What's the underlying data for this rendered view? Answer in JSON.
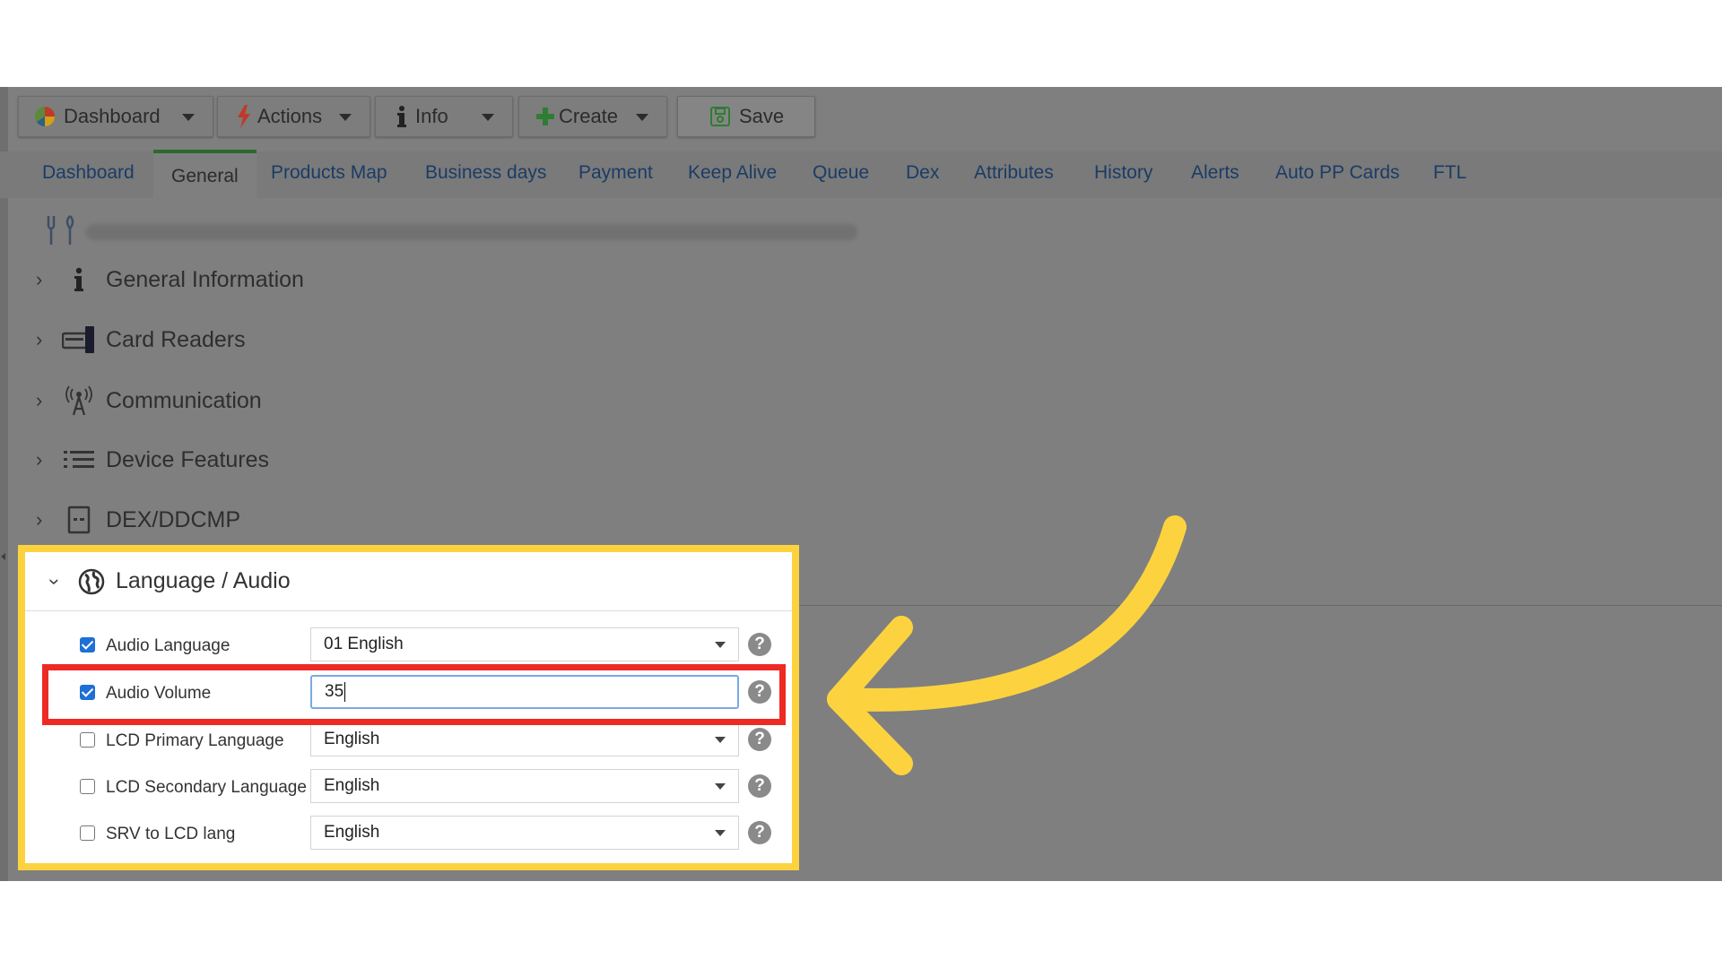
{
  "toolbar": {
    "dashboard": "Dashboard",
    "actions": "Actions",
    "info": "Info",
    "create": "Create",
    "save": "Save"
  },
  "tabs": [
    {
      "label": "Dashboard"
    },
    {
      "label": "General"
    },
    {
      "label": "Products Map"
    },
    {
      "label": "Business days"
    },
    {
      "label": "Payment"
    },
    {
      "label": "Keep Alive"
    },
    {
      "label": "Queue"
    },
    {
      "label": "Dex"
    },
    {
      "label": "Attributes"
    },
    {
      "label": "History"
    },
    {
      "label": "Alerts"
    },
    {
      "label": "Auto PP Cards"
    },
    {
      "label": "FTL"
    }
  ],
  "sections": [
    {
      "title": "General Information",
      "icon": "info-icon"
    },
    {
      "title": "Card Readers",
      "icon": "card-reader-icon"
    },
    {
      "title": "Communication",
      "icon": "antenna-icon"
    },
    {
      "title": "Device Features",
      "icon": "list-icon"
    },
    {
      "title": "DEX/DDCMP",
      "icon": "dex-icon"
    }
  ],
  "language_audio": {
    "title": "Language / Audio",
    "rows": [
      {
        "label": "Audio Language",
        "checked": true,
        "value": "01 English",
        "type": "select"
      },
      {
        "label": "Audio Volume",
        "checked": true,
        "value": "35",
        "type": "input"
      },
      {
        "label": "LCD Primary Language",
        "checked": false,
        "value": "English",
        "type": "select"
      },
      {
        "label": "LCD Secondary Language",
        "checked": false,
        "value": "English",
        "type": "select"
      },
      {
        "label": "SRV to LCD lang",
        "checked": false,
        "value": "English",
        "type": "select"
      }
    ],
    "help_glyph": "?"
  },
  "colors": {
    "highlight_border": "#fcd33f",
    "focus_box": "#ee2a24",
    "arrow": "#fcd33f",
    "tab_link": "#1a3c66",
    "active_tab_accent": "#2a6a2a"
  }
}
